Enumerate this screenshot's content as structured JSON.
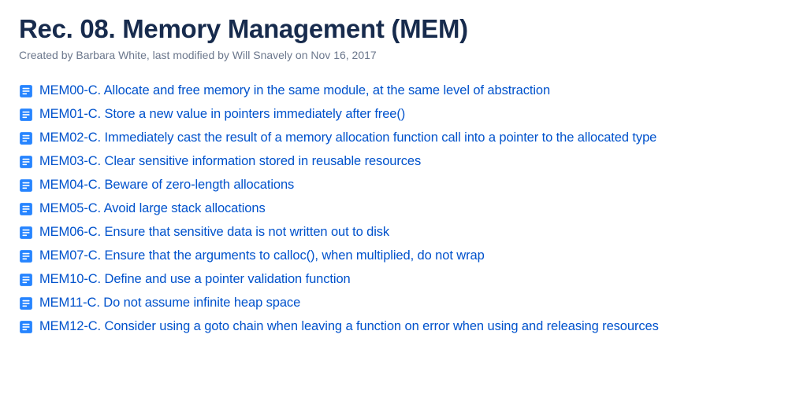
{
  "title": "Rec. 08. Memory Management (MEM)",
  "meta": {
    "created_by_prefix": "Created by ",
    "created_by": "Barbara White",
    "modified_prefix": ", last modified by ",
    "modified_by": "Will Snavely",
    "modified_on_prefix": " on ",
    "modified_on": "Nov 16, 2017"
  },
  "items": [
    {
      "label": "MEM00-C. Allocate and free memory in the same module, at the same level of abstraction"
    },
    {
      "label": "MEM01-C. Store a new value in pointers immediately after free()"
    },
    {
      "label": "MEM02-C. Immediately cast the result of a memory allocation function call into a pointer to the allocated type"
    },
    {
      "label": "MEM03-C. Clear sensitive information stored in reusable resources"
    },
    {
      "label": "MEM04-C. Beware of zero-length allocations"
    },
    {
      "label": "MEM05-C. Avoid large stack allocations"
    },
    {
      "label": "MEM06-C. Ensure that sensitive data is not written out to disk"
    },
    {
      "label": "MEM07-C. Ensure that the arguments to calloc(), when multiplied, do not wrap"
    },
    {
      "label": "MEM10-C. Define and use a pointer validation function"
    },
    {
      "label": "MEM11-C. Do not assume infinite heap space"
    },
    {
      "label": "MEM12-C. Consider using a goto chain when leaving a function on error when using and releasing resources"
    }
  ]
}
